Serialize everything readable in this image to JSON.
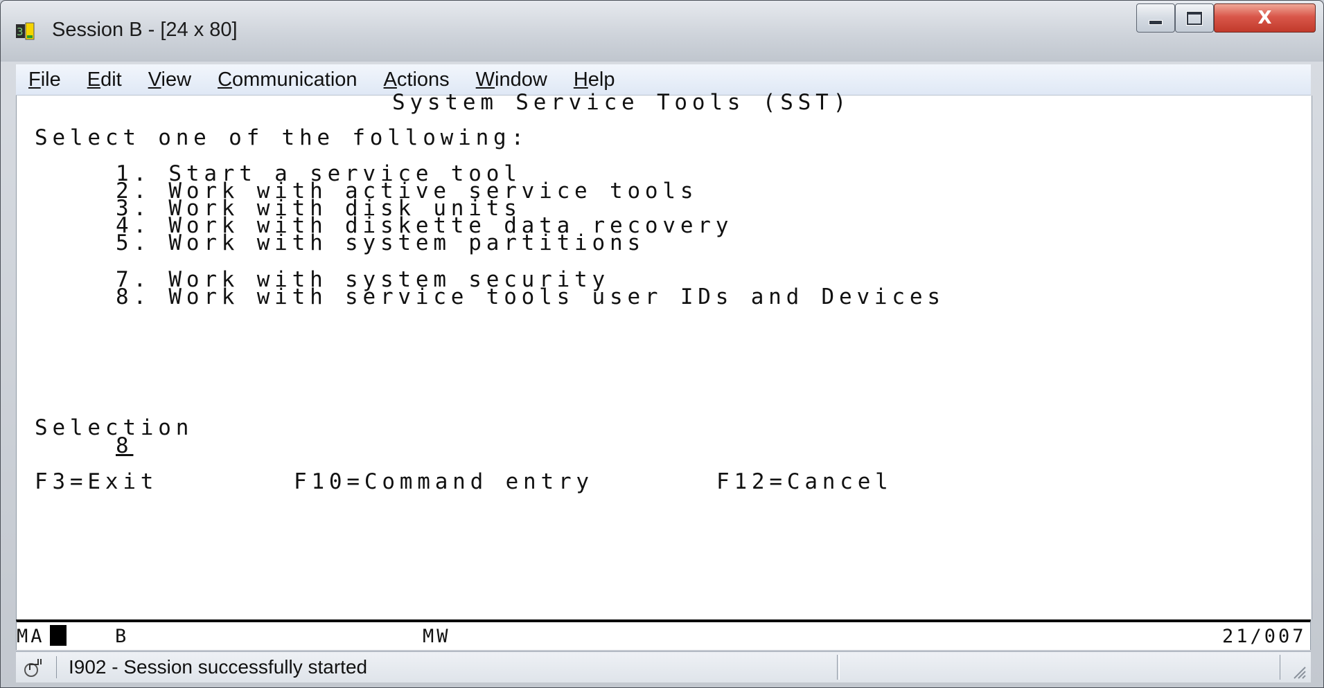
{
  "window": {
    "title": "Session B - [24 x 80]",
    "controls": {
      "close_label": "X"
    }
  },
  "menubar": {
    "items": [
      {
        "underline": "F",
        "rest": "ile"
      },
      {
        "underline": "E",
        "rest": "dit"
      },
      {
        "underline": "V",
        "rest": "iew"
      },
      {
        "underline": "C",
        "rest": "ommunication"
      },
      {
        "underline": "A",
        "rest": "ctions"
      },
      {
        "underline": "W",
        "rest": "indow"
      },
      {
        "underline": "H",
        "rest": "elp"
      }
    ]
  },
  "screen": {
    "title": "System Service Tools (SST)",
    "prompt": "Select one of the following:",
    "options": [
      "1. Start a service tool",
      "2. Work with active service tools",
      "3. Work with disk units",
      "4. Work with diskette data recovery",
      "5. Work with system partitions",
      "7. Work with system security",
      "8. Work with service tools user IDs and Devices"
    ],
    "selection_label": "Selection",
    "selection_value": "8",
    "function_keys": [
      "F3=Exit",
      "F10=Command entry",
      "F12=Cancel"
    ]
  },
  "oia": {
    "left": "MA",
    "session": "B",
    "mode": "MW",
    "cursor_position": "21/007"
  },
  "statusbar": {
    "message": "I902 - Session successfully started"
  }
}
